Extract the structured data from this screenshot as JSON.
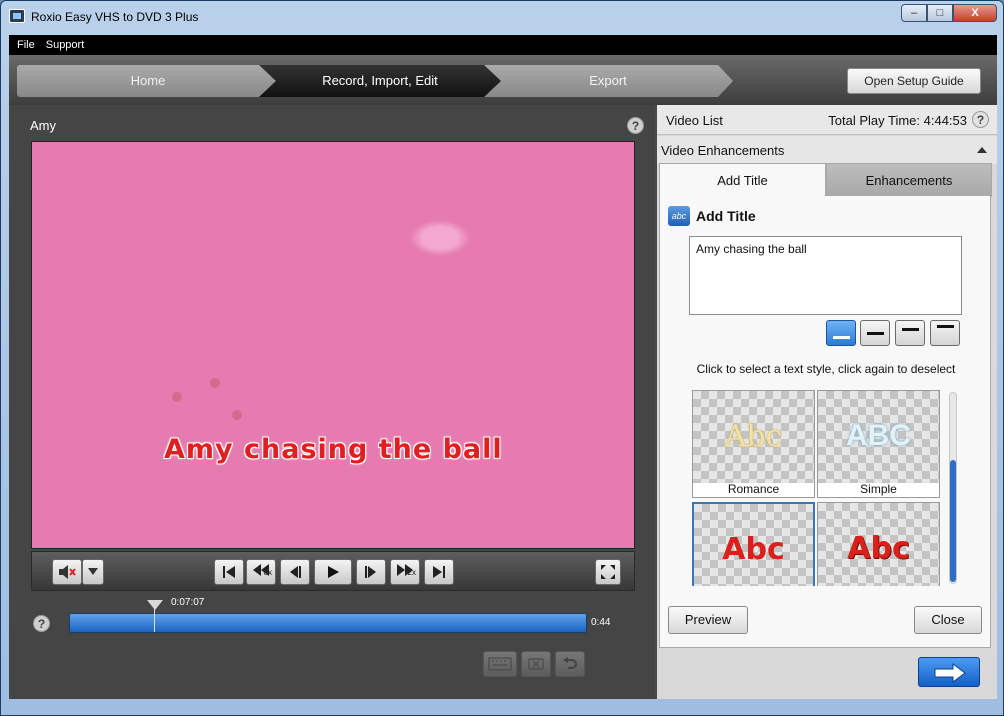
{
  "window": {
    "title": "Roxio Easy VHS to DVD 3 Plus",
    "minimize": "–",
    "maximize": "□",
    "close": "X"
  },
  "menu": [
    "File",
    "Support"
  ],
  "steps": {
    "home": "Home",
    "record": "Record, Import, Edit",
    "export": "Export"
  },
  "setup_button": "Open Setup Guide",
  "clip": {
    "name": "Amy",
    "caption": "Amy chasing the ball"
  },
  "playback": {
    "current_time": "0:07:07",
    "end_time": "0:44",
    "rewind_speed": "8x",
    "forward_speed": "2x"
  },
  "help_glyph": "?",
  "video_list": {
    "title": "Video List",
    "total_play_time": "Total Play Time: 4:44:53"
  },
  "enhancements": {
    "section_title": "Video Enhancements",
    "tabs": [
      "Add Title",
      "Enhancements"
    ],
    "icon_text": "abc",
    "header": "Add Title",
    "title_value": "Amy chasing the ball",
    "style_hint": "Click to select a text style, click again to deselect",
    "styles": [
      {
        "name": "Romance",
        "sample": "Abc",
        "color": "#f4e1a0"
      },
      {
        "name": "Simple",
        "sample": "ABC",
        "color": "#cfe6ef"
      },
      {
        "name": "",
        "sample": "Abc",
        "color": "#d9201a"
      },
      {
        "name": "",
        "sample": "Abc",
        "color": "#d9201a"
      }
    ],
    "preview_button": "Preview",
    "close_button": "Close"
  },
  "colors": {
    "accent": "#2b7bd6",
    "caption": "#e02020"
  }
}
